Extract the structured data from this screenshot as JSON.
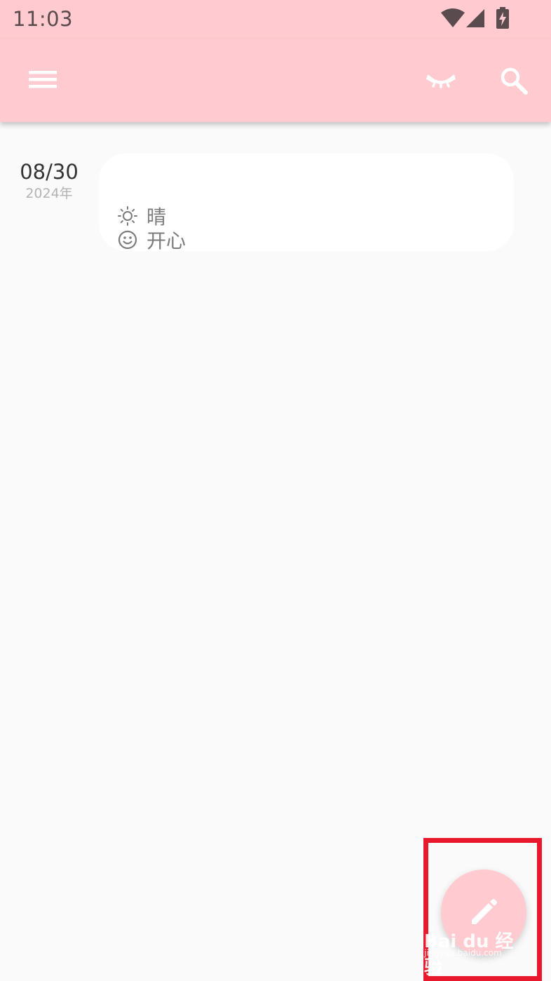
{
  "status_bar": {
    "time": "11:03",
    "icons": [
      "wifi-icon",
      "cellular-signal-icon",
      "battery-charging-icon"
    ]
  },
  "app_bar": {
    "background": "#ffcbd0",
    "actions": [
      "menu-icon",
      "eye-closed-icon",
      "search-icon"
    ]
  },
  "entries": [
    {
      "date": "08/30",
      "year": "2024年",
      "weather_icon": "sun-icon",
      "weather": "晴",
      "mood_icon": "smile-icon",
      "mood": "开心"
    }
  ],
  "fab": {
    "icon": "pencil-icon",
    "color": "#ffcbd0"
  },
  "annotation": {
    "highlight_color": "#e8192c"
  },
  "watermark": {
    "brand": "Bai du 经验",
    "url": "jingyan.baidu.com"
  }
}
